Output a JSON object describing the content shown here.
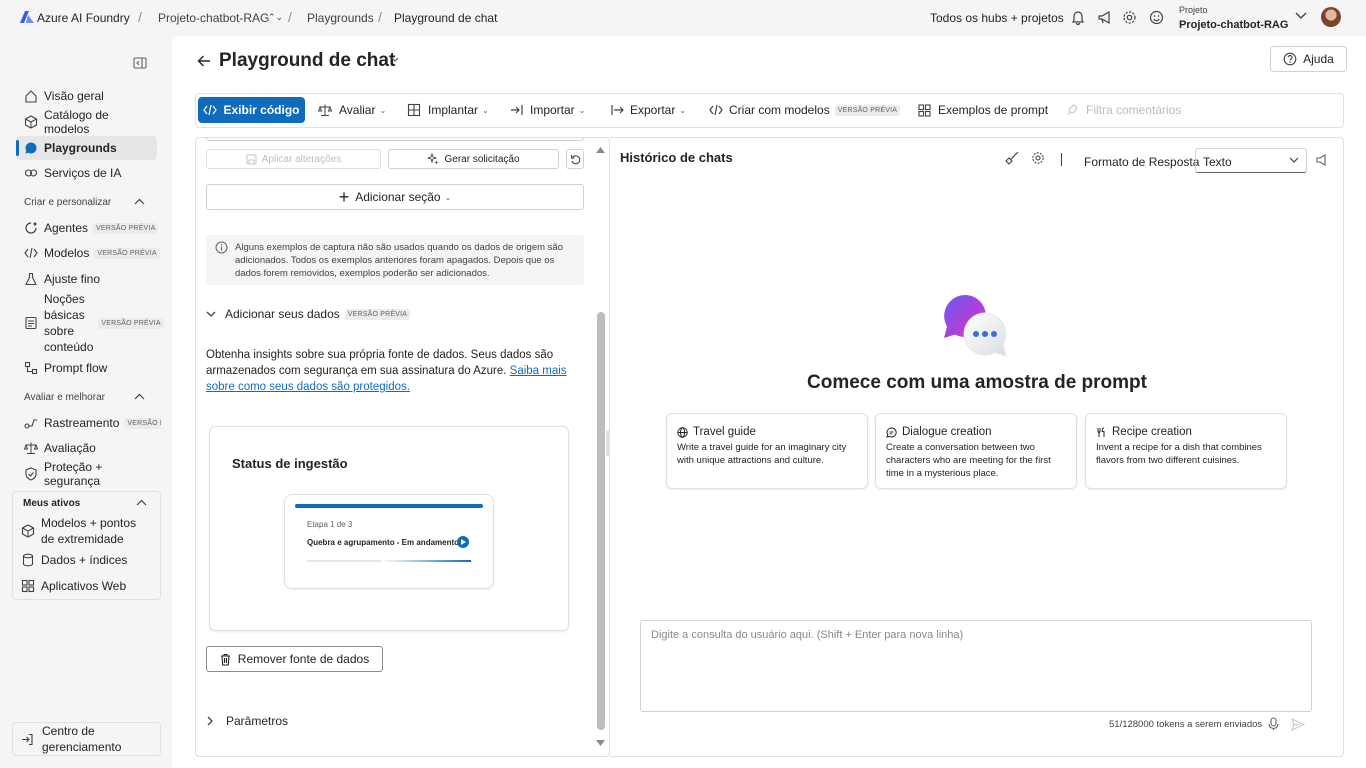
{
  "topbar": {
    "brand": "Azure AI Foundry",
    "project_crumb": "Projeto-chatbot-RAG",
    "crumb_playgrounds": "Playgrounds",
    "crumb_current": "Playground de chat",
    "hubs_link": "Todos os hubs + projetos",
    "project_label": "Projeto",
    "project_name": "Projeto-chatbot-RAG"
  },
  "sidebar": {
    "top_items": [
      {
        "label": "Visão geral",
        "icon": "home-icon"
      },
      {
        "label": "Catálogo de modelos",
        "icon": "catalog-icon"
      },
      {
        "label": "Playgrounds",
        "icon": "chat-icon"
      },
      {
        "label": "Serviços de IA",
        "icon": "ai-services-icon"
      }
    ],
    "section_create": "Criar e personalizar",
    "create_items": [
      {
        "label": "Agentes",
        "badge": "VERSÃO PRÉVIA"
      },
      {
        "label": "Modelos",
        "badge": "VERSÃO PRÉVIA"
      },
      {
        "label": "Ajuste fino"
      },
      {
        "label": "Noções básicas sobre conteúdo",
        "badge": "VERSÃO PRÉVIA"
      },
      {
        "label": "Prompt flow"
      }
    ],
    "section_eval": "Avaliar e melhorar",
    "eval_items": [
      {
        "label": "Rastreamento",
        "badge": "VERSÃO PRÉ"
      },
      {
        "label": "Avaliação"
      },
      {
        "label": "Proteção + segurança"
      }
    ],
    "section_assets": "Meus ativos",
    "asset_items": [
      {
        "label": "Modelos + pontos de extremidade"
      },
      {
        "label": "Dados + índices"
      },
      {
        "label": "Aplicativos Web"
      }
    ],
    "management": "Centro de gerenciamento"
  },
  "page": {
    "title": "Playground de chat",
    "help": "Ajuda"
  },
  "toolbar": {
    "view_code": "Exibir código",
    "evaluate": "Avaliar",
    "deploy": "Implantar",
    "import": "Importar",
    "export": "Exportar",
    "create_templates": "Criar com modelos",
    "preview_badge": "VERSÃO PRÉVIA",
    "prompt_examples": "Exemplos de prompt",
    "filter_comments": "Filtra comentários"
  },
  "setup": {
    "apply_changes": "Aplicar alterações",
    "generate_prompt": "Gerar solicitação",
    "add_section": "Adicionar seção",
    "info_text": "Alguns exemplos de captura não são usados quando os dados de origem são adicionados. Todos os exemplos anteriores foram apagados. Depois que os dados forem removidos, exemplos poderão ser adicionados.",
    "add_data_title": "Adicionar seus dados",
    "add_data_badge": "VERSÃO PRÉVIA",
    "add_data_desc": "Obtenha insights sobre sua própria fonte de dados. Seus dados são armazenados com segurança em sua assinatura do Azure.",
    "learn_more_link": "Saiba mais sobre como seus dados são protegidos.",
    "ingestion_title": "Status de ingestão",
    "ingestion_step": "Etapa 1 de 3",
    "ingestion_status": "Quebra e agrupamento - Em andamento",
    "ingestion_progress": 0.55,
    "remove_data": "Remover fonte de dados",
    "parameters": "Parâmetros"
  },
  "chat": {
    "history_title": "Histórico de chats",
    "response_format_label": "Formato de Resposta",
    "response_format_value": "Texto",
    "empty_title": "Comece com uma amostra de prompt",
    "samples": [
      {
        "title": "Travel guide",
        "desc": "Write a travel guide for an imaginary city with unique attractions and culture.",
        "icon": "globe-icon"
      },
      {
        "title": "Dialogue creation",
        "desc": "Create a conversation between two characters who are meeting for the first time in a mysterious place.",
        "icon": "dialogue-icon"
      },
      {
        "title": "Recipe creation",
        "desc": "Invent a recipe for a dish that combines flavors from two different cuisines.",
        "icon": "utensils-icon"
      }
    ],
    "input_placeholder": "Digite a consulta do usuário aqui. (Shift + Enter para nova linha)",
    "token_count": "51/128000 tokens a serem enviados"
  },
  "colors": {
    "accent": "#0f6cbd",
    "link": "#0f6cbd"
  }
}
